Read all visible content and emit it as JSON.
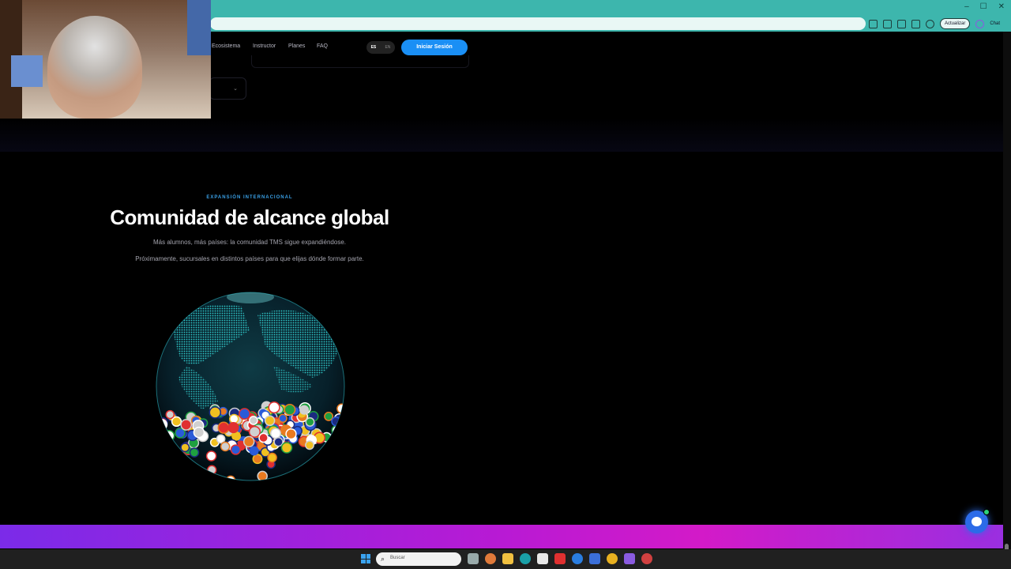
{
  "browser": {
    "update_label": "Actualizar",
    "chat_label": "Chat",
    "controls": [
      "–",
      "☐",
      "✕"
    ]
  },
  "nav": {
    "links": [
      "Ecosistema",
      "Instructor",
      "Planes",
      "FAQ"
    ],
    "lang_es": "ES",
    "lang_en": "EN",
    "login_label": "Iniciar Sesión"
  },
  "section": {
    "eyebrow": "EXPANSIÓN INTERNACIONAL",
    "title": "Comunidad de alcance global",
    "subtitle1": "Más alumnos, más países: la comunidad TMS sigue expandiéndose.",
    "subtitle2": "Próximamente, sucursales en distintos países para que elijas dónde formar parte."
  },
  "taskbar": {
    "search_placeholder": "Buscar"
  },
  "colors": {
    "accent": "#1a8ff5",
    "eyebrow": "#3aa0e6",
    "browser_chrome": "#3db6ad"
  }
}
